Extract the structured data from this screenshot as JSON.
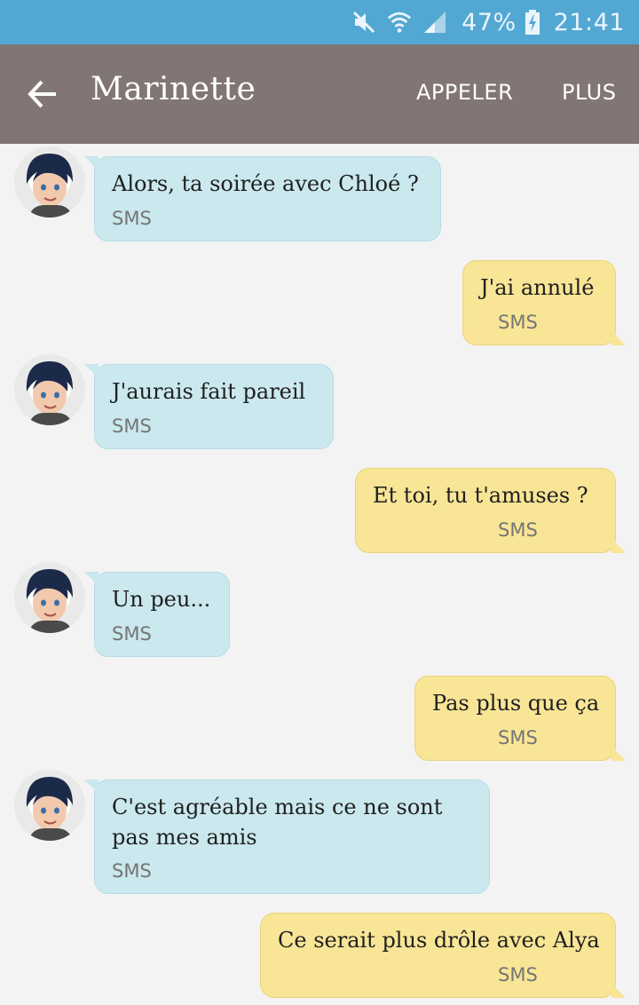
{
  "status_bar": {
    "battery_percent": "47%",
    "time": "21:41",
    "icons": [
      "mute-icon",
      "wifi-icon",
      "signal-icon",
      "battery-charging-icon"
    ]
  },
  "app_bar": {
    "contact_name": "Marinette",
    "call_label": "APPELER",
    "more_label": "PLUS",
    "back_icon": "arrow-left-icon"
  },
  "messages": [
    {
      "direction": "incoming",
      "text": "Alors, ta soirée avec Chloé ?",
      "meta": "SMS"
    },
    {
      "direction": "outgoing",
      "text": "J'ai annulé",
      "meta": "SMS"
    },
    {
      "direction": "incoming",
      "text": "J'aurais fait pareil",
      "meta": "SMS"
    },
    {
      "direction": "outgoing",
      "text": "Et toi, tu t'amuses ?",
      "meta": "SMS"
    },
    {
      "direction": "incoming",
      "text": "Un peu...",
      "meta": "SMS"
    },
    {
      "direction": "outgoing",
      "text": "Pas plus que ça",
      "meta": "SMS"
    },
    {
      "direction": "incoming",
      "text": "C'est agréable mais ce ne sont\npas mes amis",
      "meta": "SMS"
    },
    {
      "direction": "outgoing",
      "text": "Ce serait plus drôle avec Alya",
      "meta": "SMS"
    }
  ],
  "colors": {
    "status_bar": "#52a8d3",
    "app_bar": "#827674",
    "incoming_bubble": "#cae8ee",
    "outgoing_bubble": "#f8e596",
    "background": "#f3f3f3"
  }
}
